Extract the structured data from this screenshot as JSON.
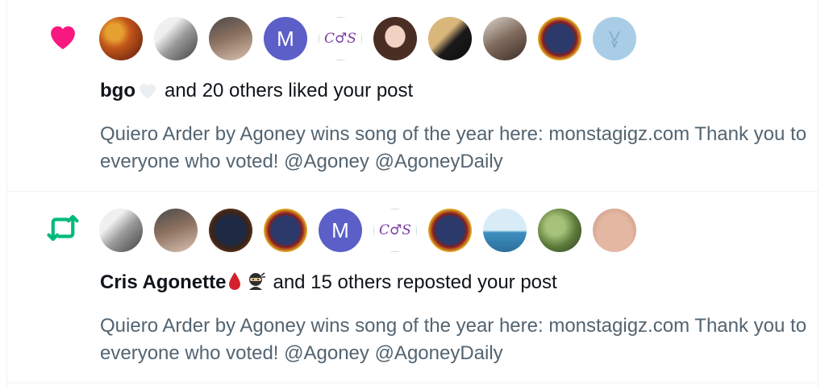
{
  "notifications": [
    {
      "type": "like",
      "icon": "heart-icon",
      "icon_color": "#f91880",
      "avatars": [
        "autumn-leaves",
        "bw-gym-selfie",
        "couple-selfie",
        "letter-m",
        "cs-logo",
        "smiling-woman",
        "sunset-silhouette",
        "duo-photo",
        "agoney-album",
        "pale-blue-logo"
      ],
      "avatar_letters": {
        "letter-m": "M",
        "cs-logo": "C♂S"
      },
      "actor": "bgo",
      "actor_emoji": "white-heart",
      "summary": "and 20 others liked your post",
      "post_text": "Quiero Arder by Agoney wins song of the year here: monstagigz.com Thank you to everyone who voted! @Agoney @AgoneyDaily"
    },
    {
      "type": "repost",
      "icon": "repost-icon",
      "icon_color": "#00ba7c",
      "avatars": [
        "bw-gym-selfie",
        "couple-selfie",
        "agoney-dark",
        "agoney-album",
        "letter-m",
        "cs-logo",
        "agoney-album",
        "boat-illustration",
        "foliage-portrait",
        "face-closeup"
      ],
      "avatar_letters": {
        "letter-m": "M",
        "cs-logo": "C♂S"
      },
      "actor": "Cris Agonette",
      "actor_emoji": [
        "blood-drop",
        "ninja"
      ],
      "summary": "and 15 others reposted your post",
      "post_text": "Quiero Arder by Agoney wins song of the year here: monstagigz.com Thank you to everyone who voted! @Agoney @AgoneyDaily"
    }
  ]
}
